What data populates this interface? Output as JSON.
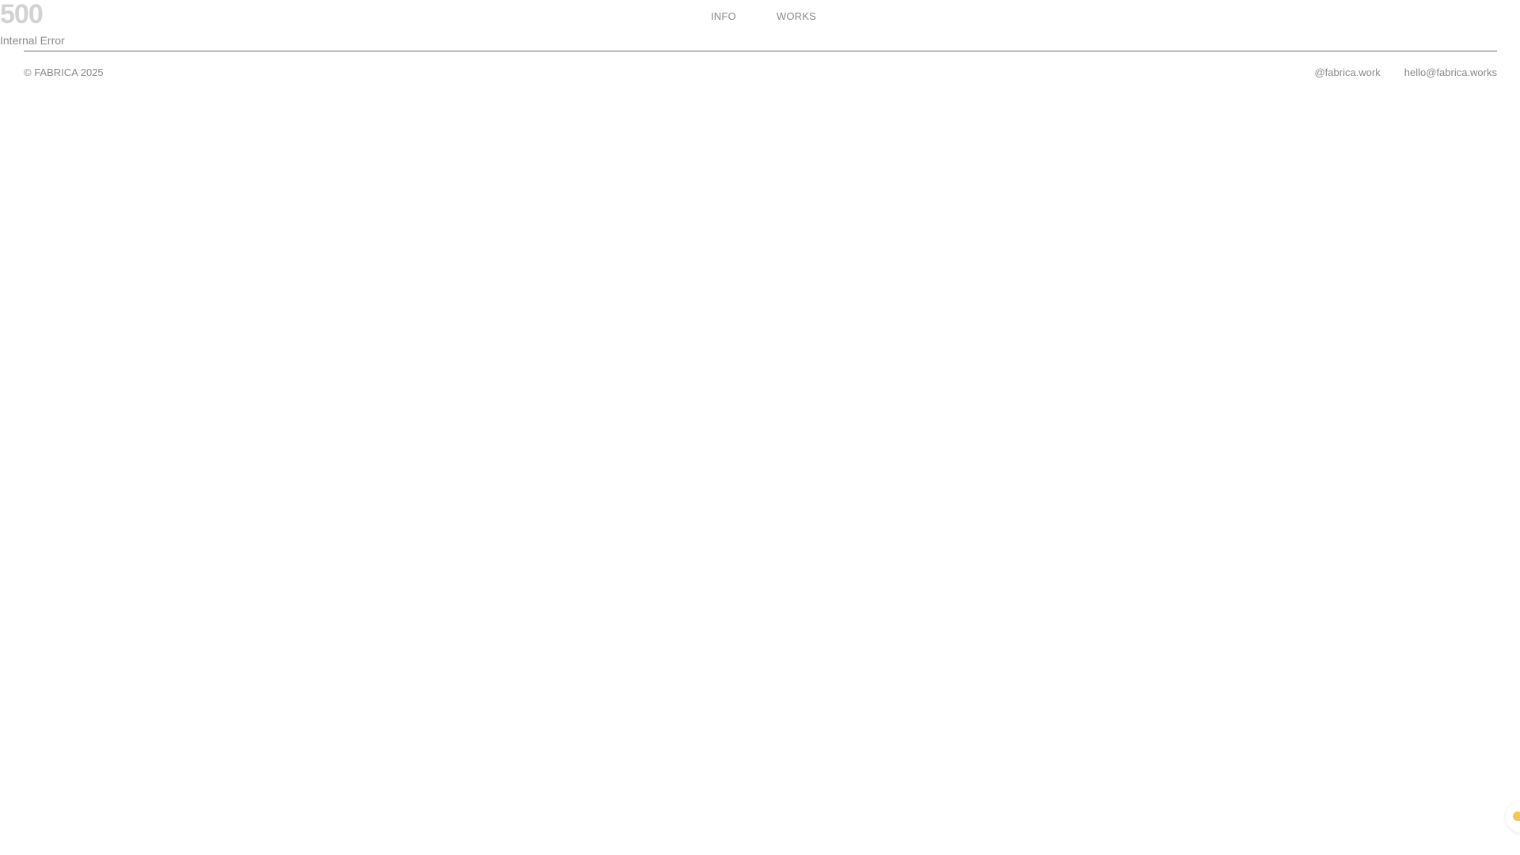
{
  "error": {
    "code": "500",
    "message": "Internal Error"
  },
  "nav": {
    "items": [
      {
        "label": "INFO"
      },
      {
        "label": "WORKS"
      }
    ]
  },
  "footer": {
    "copyright": "© FABRICA 2025",
    "links": [
      {
        "label": "@fabrica.work"
      },
      {
        "label": "hello@fabrica.works"
      }
    ]
  },
  "corner_widget": {
    "icon": "chat-bubble-icon",
    "accent_color": "#f3c75a"
  },
  "colors": {
    "error_code": "#d2d2d2",
    "text": "#8a8a8a",
    "divider": "#6e6e6e",
    "background": "#ffffff"
  }
}
